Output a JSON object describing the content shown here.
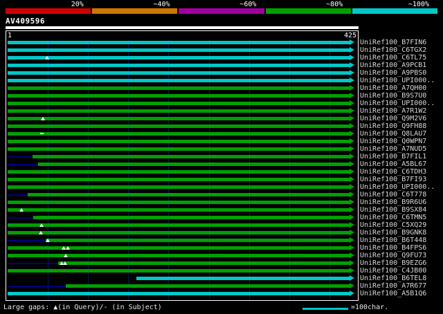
{
  "key": {
    "segments": [
      {
        "label": "20%",
        "color": "#d00000"
      },
      {
        "label": "~40%",
        "color": "#cc7700"
      },
      {
        "label": "~60%",
        "color": "#a000a0"
      },
      {
        "label": "~80%",
        "color": "#00a000"
      },
      {
        "label": "~100%",
        "color": "#00c8c8"
      }
    ]
  },
  "query": {
    "name": "AV409596"
  },
  "scale": {
    "start": "1",
    "end": "425",
    "length": 425,
    "gridlines": [
      50,
      100,
      150,
      200,
      250,
      300,
      350,
      400
    ]
  },
  "colors": {
    "cyan": "#00c8c8",
    "green": "#00a000",
    "lead": "#000080"
  },
  "footer": {
    "gaps_note": "Large gaps: ▲(in Query)/- (in Subject)",
    "scale_legend": "=100char."
  },
  "rows": [
    {
      "label": "UniRef100_B7FIN6",
      "color": "cyan",
      "start": 0,
      "end": 425
    },
    {
      "label": "UniRef100_C6TGX2",
      "color": "cyan",
      "start": 0,
      "end": 425
    },
    {
      "label": "UniRef100_C6TL75",
      "color": "cyan",
      "start": 0,
      "end": 425,
      "markers": [
        {
          "pos": 49,
          "type": "tri"
        }
      ]
    },
    {
      "label": "UniRef100_A9PCB1",
      "color": "cyan",
      "start": 0,
      "end": 425
    },
    {
      "label": "UniRef100_A9PBS0",
      "color": "cyan",
      "start": 0,
      "end": 425
    },
    {
      "label": "UniRef100_UPI000..",
      "color": "cyan",
      "start": 0,
      "end": 425
    },
    {
      "label": "UniRef100_A7QH00",
      "color": "green",
      "start": 0,
      "end": 425
    },
    {
      "label": "UniRef100_B9S7U0",
      "color": "green",
      "start": 0,
      "end": 425
    },
    {
      "label": "UniRef100_UPI000..",
      "color": "green",
      "start": 0,
      "end": 425
    },
    {
      "label": "UniRef100_A7R1W2",
      "color": "green",
      "start": 0,
      "end": 425
    },
    {
      "label": "UniRef100_Q9M2V6",
      "color": "green",
      "start": 0,
      "end": 425,
      "markers": [
        {
          "pos": 44,
          "type": "tri"
        }
      ]
    },
    {
      "label": "UniRef100_Q9FH88",
      "color": "green",
      "start": 0,
      "end": 425
    },
    {
      "label": "UniRef100_Q8LAU7",
      "color": "green",
      "start": 0,
      "end": 425,
      "markers": [
        {
          "pos": 42,
          "type": "dash"
        }
      ]
    },
    {
      "label": "UniRef100_Q0WPN7",
      "color": "green",
      "start": 0,
      "end": 425
    },
    {
      "label": "UniRef100_A7NUD5",
      "color": "green",
      "start": 0,
      "end": 425
    },
    {
      "label": "UniRef100_B7FIL1",
      "color": "green",
      "start": 31,
      "end": 425,
      "lead_from": 0
    },
    {
      "label": "UniRef100_A5BL67",
      "color": "green",
      "start": 38,
      "end": 425,
      "lead_from": 0
    },
    {
      "label": "UniRef100_C6TDH3",
      "color": "green",
      "start": 0,
      "end": 425
    },
    {
      "label": "UniRef100_B7FI93",
      "color": "green",
      "start": 0,
      "end": 425
    },
    {
      "label": "UniRef100_UPI000..",
      "color": "green",
      "start": 0,
      "end": 425
    },
    {
      "label": "UniRef100_C6T778",
      "color": "green",
      "start": 25,
      "end": 425,
      "lead_from": 0
    },
    {
      "label": "UniRef100_B9R6U6",
      "color": "green",
      "start": 0,
      "end": 425
    },
    {
      "label": "UniRef100_B9SX84",
      "color": "green",
      "start": 0,
      "end": 425,
      "markers": [
        {
          "pos": 17,
          "type": "tri"
        }
      ]
    },
    {
      "label": "UniRef100_C6TMN5",
      "color": "green",
      "start": 32,
      "end": 425,
      "lead_from": 0
    },
    {
      "label": "UniRef100_C5XQ29",
      "color": "green",
      "start": 0,
      "end": 425,
      "markers": [
        {
          "pos": 42,
          "type": "tri"
        }
      ]
    },
    {
      "label": "UniRef100_B9GNK8",
      "color": "green",
      "start": 0,
      "end": 425,
      "markers": [
        {
          "pos": 41,
          "type": "tri"
        }
      ]
    },
    {
      "label": "UniRef100_B6T448",
      "color": "green",
      "start": 47,
      "end": 425,
      "lead_from": 0,
      "markers": [
        {
          "pos": 50,
          "type": "tri"
        }
      ]
    },
    {
      "label": "UniRef100_B4FPS6",
      "color": "green",
      "start": 0,
      "end": 425,
      "markers": [
        {
          "pos": 70,
          "type": "tri"
        },
        {
          "pos": 75,
          "type": "tri"
        }
      ]
    },
    {
      "label": "UniRef100_Q9FU73",
      "color": "green",
      "start": 0,
      "end": 425,
      "markers": [
        {
          "pos": 72,
          "type": "tri"
        }
      ]
    },
    {
      "label": "UniRef100_B9EZG6",
      "color": "green",
      "start": 63,
      "end": 425,
      "lead_from": 0,
      "markers": [
        {
          "pos": 67,
          "type": "tri"
        },
        {
          "pos": 71,
          "type": "tri"
        }
      ]
    },
    {
      "label": "UniRef100_C4JB00",
      "color": "green",
      "start": 0,
      "end": 425
    },
    {
      "label": "UniRef100_B6TEL8",
      "color": "cyan",
      "start": 160,
      "end": 425
    },
    {
      "label": "UniRef100_A7R677",
      "color": "green",
      "start": 72,
      "end": 425,
      "lead_from": 0
    },
    {
      "label": "UniRef100_A5B1Q6",
      "color": "cyan",
      "start": 0,
      "end": 425
    }
  ]
}
